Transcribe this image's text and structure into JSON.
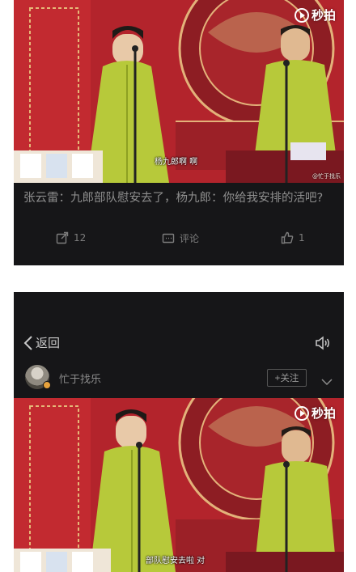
{
  "post1": {
    "watermark": "秒拍",
    "subtitle": "杨九郎啊 啊",
    "credit": "@忙于找乐",
    "text": "张云雷：九郎部队慰安去了，杨九郎：你给我安排的活吧?",
    "share_count": "12",
    "comment_label": "评论",
    "like_count": "1"
  },
  "post2": {
    "back_label": "返回",
    "author": "忙于找乐",
    "follow_label": "+关注",
    "watermark": "秒拍",
    "subtitle": "部队慰安去啦 对"
  },
  "colors": {
    "background_dark": "#161618",
    "curtain_red": "#b3242c",
    "robe_green": "#b7c93a"
  },
  "icons": [
    "share-icon",
    "comment-icon",
    "like-icon",
    "back-chevron-icon",
    "speaker-icon",
    "chevron-down-icon",
    "miaopai-logo-icon"
  ]
}
